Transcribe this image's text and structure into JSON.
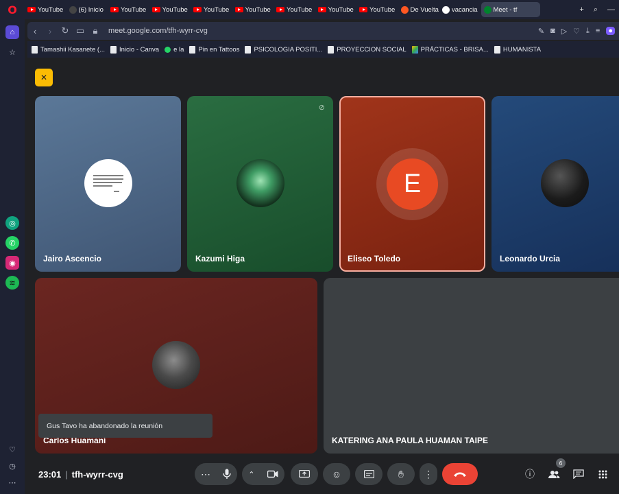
{
  "browser": {
    "tabs": [
      {
        "label": "YouTube",
        "icon": "youtube-icon"
      },
      {
        "label": "(6) Inicio",
        "icon": "threads-icon"
      },
      {
        "label": "YouTube",
        "icon": "youtube-icon"
      },
      {
        "label": "YouTube",
        "icon": "youtube-icon"
      },
      {
        "label": "YouTube",
        "icon": "youtube-icon"
      },
      {
        "label": "YouTube",
        "icon": "youtube-icon"
      },
      {
        "label": "YouTube",
        "icon": "youtube-icon"
      },
      {
        "label": "YouTube",
        "icon": "youtube-icon"
      },
      {
        "label": "YouTube",
        "icon": "youtube-icon"
      },
      {
        "label": "De Vuelta",
        "icon": "site-icon"
      },
      {
        "label": "vacancia",
        "icon": "google-icon"
      },
      {
        "label": "Meet - tf",
        "icon": "meet-icon"
      }
    ],
    "url": "meet.google.com/tfh-wyrr-cvg",
    "bookmarks": [
      "Tamashii Kasanete (...",
      "Inicio - Canva",
      "e la",
      "Pin en Tattoos",
      "PSICOLOGIA POSITI...",
      "PROYECCION SOCIAL",
      "PRÁCTICAS - BRISA...",
      "HUMANISTA"
    ]
  },
  "meet": {
    "participants": [
      {
        "name": "Jairo Ascencio",
        "color": "#4e6784"
      },
      {
        "name": "Kazumi Higa",
        "color": "#1e5b34",
        "muted": true
      },
      {
        "name": "Eliseo Toledo",
        "color": "#8e2a14",
        "initial": "E",
        "speaking": true
      },
      {
        "name": "Leonardo Urcia",
        "color": "#1c3a63"
      },
      {
        "name": "Carlos Huamaní",
        "color": "#5a201c"
      },
      {
        "name": "KATERING ANA PAULA HUAMAN TAIPE",
        "color": "#3c4043"
      }
    ],
    "toast": "Gus Tavo ha abandonado la reunión",
    "time": "23:01",
    "meeting_code": "tfh-wyrr-cvg",
    "people_count": "6",
    "end_call_color": "#ea4335"
  }
}
